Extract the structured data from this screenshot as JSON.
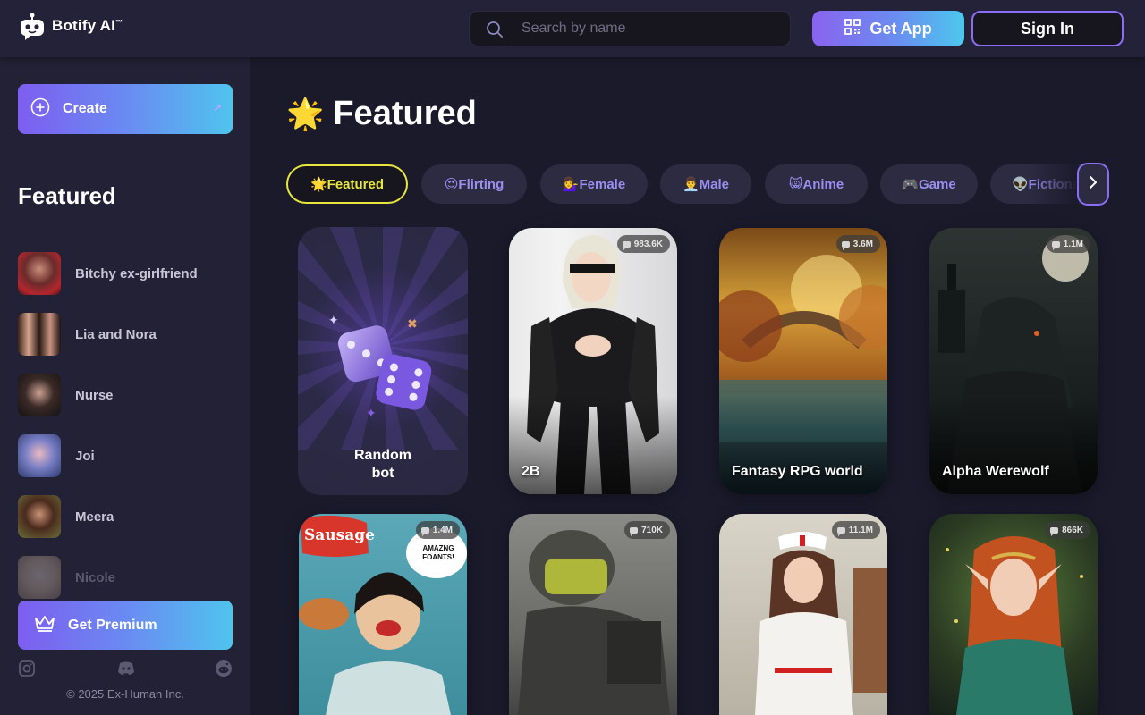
{
  "header": {
    "logo_text": "Botify AI",
    "logo_tm": "™",
    "search_placeholder": "Search by name",
    "get_app_label": "Get App",
    "sign_in_label": "Sign In"
  },
  "sidebar": {
    "create_label": "Create",
    "section_title": "Featured",
    "items": [
      {
        "label": "Bitchy ex-girlfriend"
      },
      {
        "label": "Lia and Nora"
      },
      {
        "label": "Nurse"
      },
      {
        "label": "Joi"
      },
      {
        "label": "Meera"
      },
      {
        "label": "Nicole"
      }
    ],
    "premium_label": "Get Premium",
    "socials": [
      "instagram-icon",
      "discord-icon",
      "reddit-icon"
    ],
    "copyright": "© 2025 Ex-Human Inc."
  },
  "main": {
    "title_emoji": "🌟",
    "title": "Featured",
    "chips": [
      {
        "label": "🌟Featured",
        "active": true
      },
      {
        "label": "😍Flirting"
      },
      {
        "label": "💁‍♀️Female"
      },
      {
        "label": "👨‍💼Male"
      },
      {
        "label": "😸Anime"
      },
      {
        "label": "🎮Game"
      },
      {
        "label": "👽Fictional"
      }
    ],
    "random_card": {
      "line1": "Random",
      "line2": "bot"
    },
    "cards": [
      {
        "name": "2B",
        "count": "983.6K"
      },
      {
        "name": "Fantasy RPG world",
        "count": "3.6M"
      },
      {
        "name": "Alpha Werewolf",
        "count": "1.1M"
      },
      {
        "name": "",
        "count": "1.4M"
      },
      {
        "name": "",
        "count": "710K"
      },
      {
        "name": "",
        "count": "11.1M"
      },
      {
        "name": "",
        "count": "866K"
      }
    ],
    "poster_text": {
      "sausage": "Sausage",
      "bubble": "AMAZNG FOANTS!"
    }
  },
  "colors": {
    "accent_purple": "#8a6ef5",
    "gradient_start": "#7d5ef0",
    "gradient_end": "#4fc4ee",
    "active_chip": "#e8e63c",
    "chip_text": "#9a8ff0"
  }
}
